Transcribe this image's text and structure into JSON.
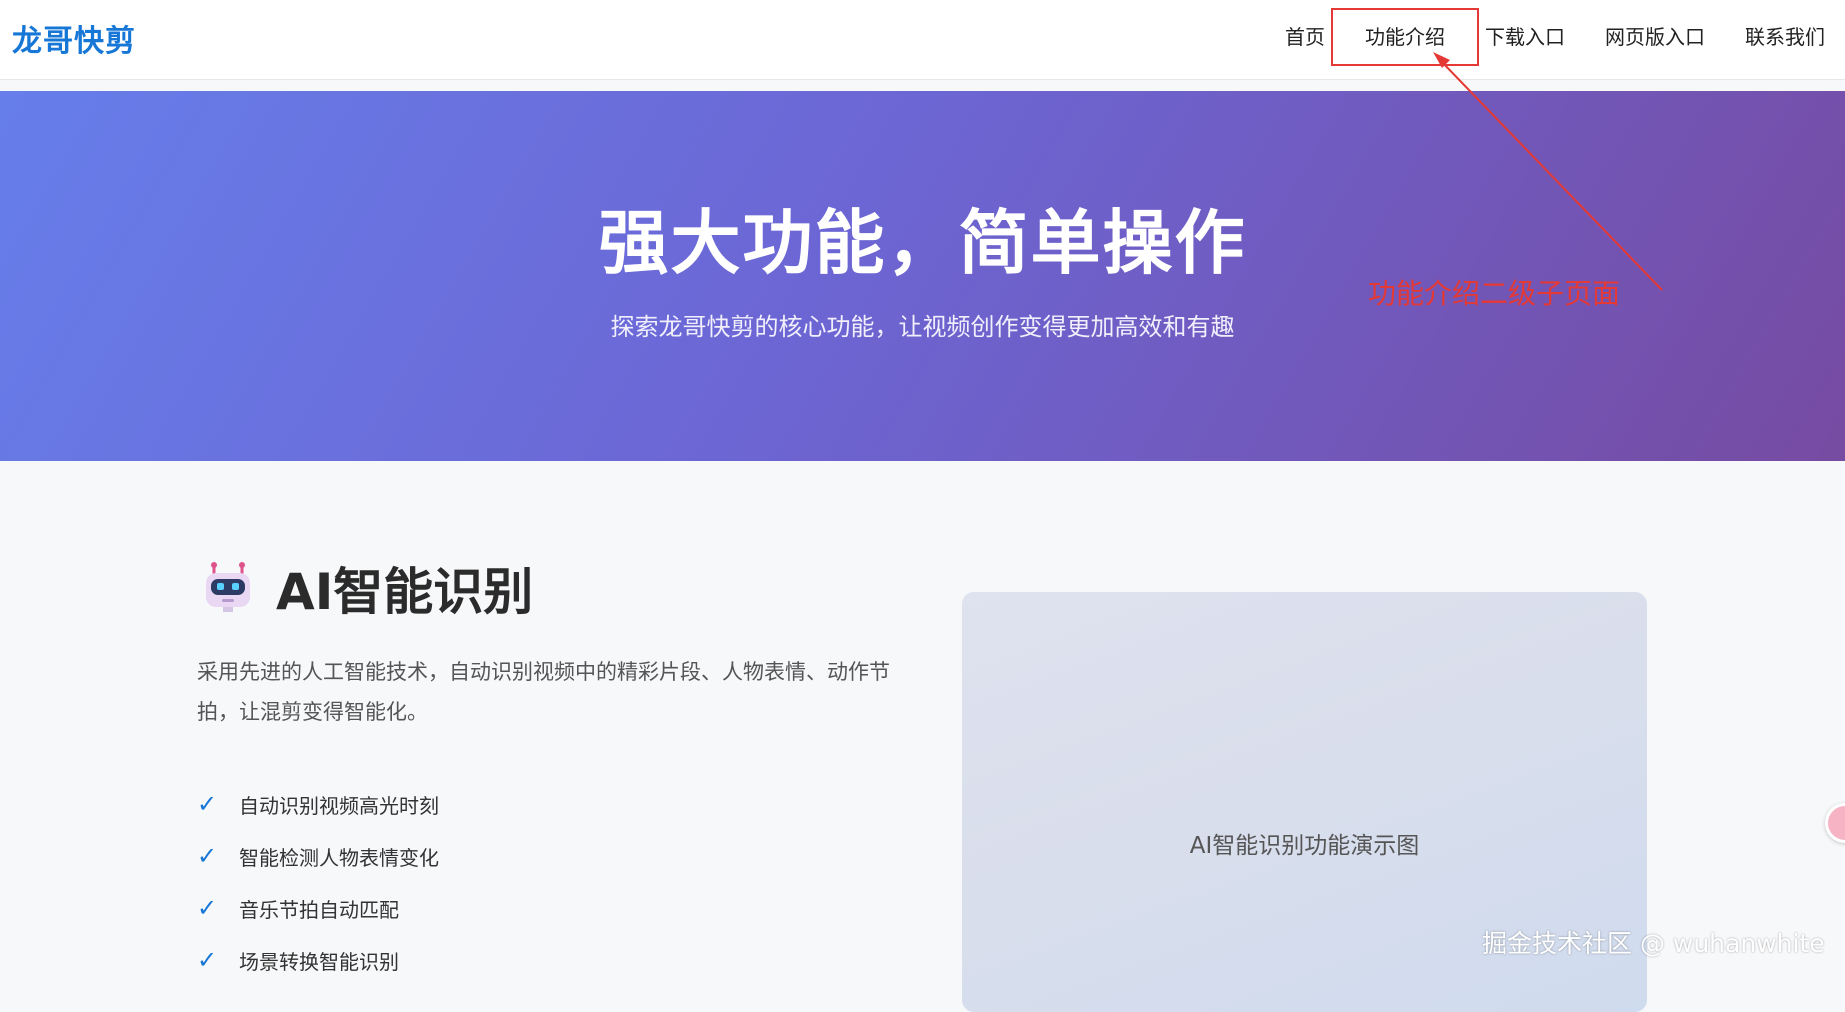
{
  "header": {
    "logo": "龙哥快剪",
    "nav": [
      {
        "label": "首页"
      },
      {
        "label": "功能介绍"
      },
      {
        "label": "下载入口"
      },
      {
        "label": "网页版入口"
      },
      {
        "label": "联系我们"
      }
    ]
  },
  "hero": {
    "title": "强大功能，简单操作",
    "subtitle": "探索龙哥快剪的核心功能，让视频创作变得更加高效和有趣"
  },
  "annotation": {
    "label": "功能介绍二级子页面",
    "color": "#e53935"
  },
  "feature": {
    "icon": "robot-icon",
    "title": "AI智能识别",
    "description": "采用先进的人工智能技术，自动识别视频中的精彩片段、人物表情、动作节拍，让混剪变得智能化。",
    "check_symbol": "✓",
    "items": [
      "自动识别视频高光时刻",
      "智能检测人物表情变化",
      "音乐节拍自动匹配",
      "场景转换智能识别"
    ],
    "demo_label": "AI智能识别功能演示图"
  },
  "watermark": "掘金技术社区 @ wuhanwhite",
  "colors": {
    "brand": "#1677d6",
    "hero_gradient_start": "#667eea",
    "hero_gradient_end": "#764ba2"
  }
}
